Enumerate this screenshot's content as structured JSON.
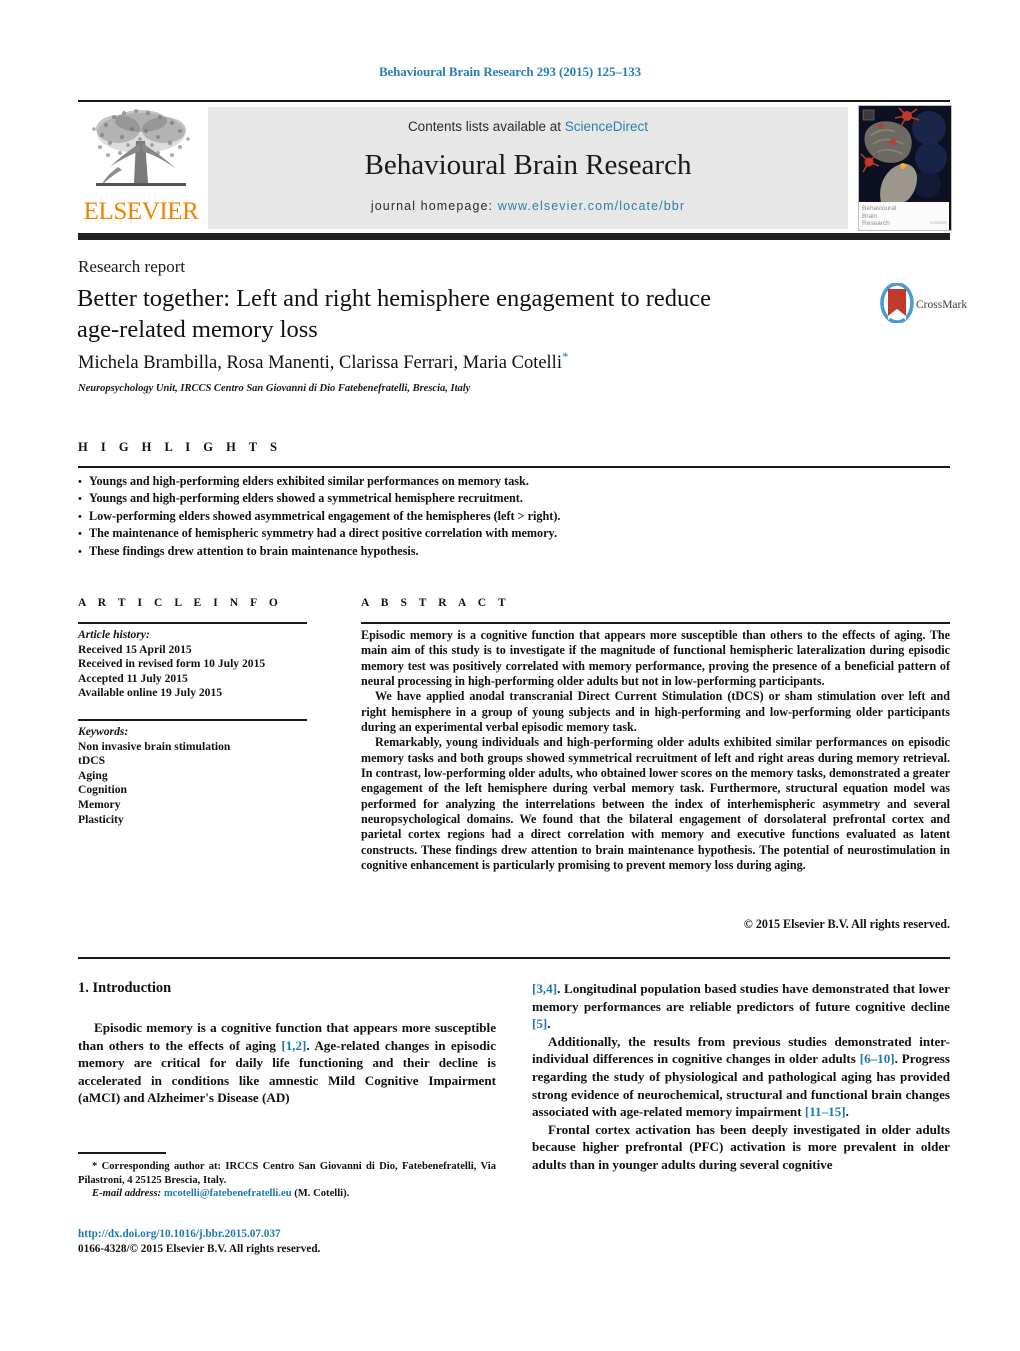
{
  "running_head": "Behavioural Brain Research 293 (2015) 125–133",
  "masthead": {
    "contents_prefix": "Contents lists available at ",
    "sciencedirect": "ScienceDirect",
    "journal_title": "Behavioural Brain Research",
    "homepage_prefix": "journal homepage: ",
    "homepage_url": "www.elsevier.com/locate/bbr",
    "publisher_wordmark": "ELSEVIER",
    "publisher_color": "#ef8200",
    "link_color": "#2a7fad",
    "box_bg": "#e7e7e7",
    "cover_caption_line1": "Behavioural",
    "cover_caption_line2": "Brain",
    "cover_caption_line3": "Research"
  },
  "article": {
    "type": "Research report",
    "title_line1": "Better together: Left and right hemisphere engagement to reduce",
    "title_line2": "age-related memory loss",
    "authors": "Michela Brambilla, Rosa Manenti, Clarissa Ferrari, Maria Cotelli",
    "author_marker": "*",
    "affiliation": "Neuropsychology Unit, IRCCS Centro San Giovanni di Dio Fatebenefratelli, Brescia, Italy",
    "crossmark_label": "CrossMark"
  },
  "highlights": {
    "header": "H I G H L I G H T S",
    "items": [
      "Youngs and high-performing elders exhibited similar performances on memory task.",
      "Youngs and high-performing elders showed a symmetrical hemisphere recruitment.",
      "Low-performing elders showed asymmetrical engagement of the hemispheres (left > right).",
      "The maintenance of hemispheric symmetry had a direct positive correlation with memory.",
      "These findings drew attention to brain maintenance hypothesis."
    ]
  },
  "article_info": {
    "header": "A R T I C L E    I N F O",
    "history_label": "Article history:",
    "history": [
      "Received 15 April 2015",
      "Received in revised form 10 July 2015",
      "Accepted 11 July 2015",
      "Available online 19 July 2015"
    ],
    "keywords_label": "Keywords:",
    "keywords": [
      "Non invasive brain stimulation",
      "tDCS",
      "Aging",
      "Cognition",
      "Memory",
      "Plasticity"
    ]
  },
  "abstract": {
    "header": "A B S T R A C T",
    "p1": "Episodic memory is a cognitive function that appears more susceptible than others to the effects of aging. The main aim of this study is to investigate if the magnitude of functional hemispheric lateralization during episodic memory test was positively correlated with memory performance, proving the presence of a beneficial pattern of neural processing in high-performing older adults but not in low-performing participants.",
    "p2": "We have applied anodal transcranial Direct Current Stimulation (tDCS) or sham stimulation over left and right hemisphere in a group of young subjects and in high-performing and low-performing older participants during an experimental verbal episodic memory task.",
    "p3": "Remarkably, young individuals and high-performing older adults exhibited similar performances on episodic memory tasks and both groups showed symmetrical recruitment of left and right areas during memory retrieval. In contrast, low-performing older adults, who obtained lower scores on the memory tasks, demonstrated a greater engagement of the left hemisphere during verbal memory task. Furthermore, structural equation model was performed for analyzing the interrelations between the index of interhemispheric asymmetry and several neuropsychological domains. We found that the bilateral engagement of dorsolateral prefrontal cortex and parietal cortex regions had a direct correlation with memory and executive functions evaluated as latent constructs. These findings drew attention to brain maintenance hypothesis. The potential of neurostimulation in cognitive enhancement is particularly promising to prevent memory loss during aging.",
    "copyright": "© 2015 Elsevier B.V. All rights reserved."
  },
  "body": {
    "section1_heading": "1. Introduction",
    "left_p1_a": "Episodic memory is a cognitive function that appears more susceptible than others to the effects of aging ",
    "left_p1_ref1": "[1,2]",
    "left_p1_b": ". Age-related changes in episodic memory are critical for daily life functioning and their decline is accelerated in conditions like amnestic Mild Cognitive Impairment (aMCI) and Alzheimer's Disease (AD)",
    "right_p1_ref": "[3,4]",
    "right_p1_a": ". Longitudinal population based studies have demonstrated that lower memory performances are reliable predictors of future cognitive decline ",
    "right_p1_ref2": "[5]",
    "right_p1_b": ".",
    "right_p2_a": "Additionally, the results from previous studies demonstrated inter-individual differences in cognitive changes in older adults ",
    "right_p2_ref": "[6–10]",
    "right_p2_b": ". Progress regarding the study of physiological and pathological aging has provided strong evidence of neurochemical, structural and functional brain changes associated with age-related memory impairment ",
    "right_p2_ref2": "[11–15]",
    "right_p2_c": ".",
    "right_p3": "Frontal cortex activation has been deeply investigated in older adults because higher prefrontal (PFC) activation is more prevalent in older adults than in younger adults during several cognitive"
  },
  "footer": {
    "corr_marker": "*",
    "corr_text": " Corresponding author at: IRCCS Centro San Giovanni di Dio, Fatebenefratelli, Via Pilastroni, 4 25125 Brescia, Italy.",
    "email_label": "E-mail address:",
    "email": "mcotelli@fatebenefratelli.eu",
    "email_suffix": " (M. Cotelli).",
    "doi": "http://dx.doi.org/10.1016/j.bbr.2015.07.037",
    "issn": "0166-4328/© 2015 Elsevier B.V. All rights reserved."
  }
}
